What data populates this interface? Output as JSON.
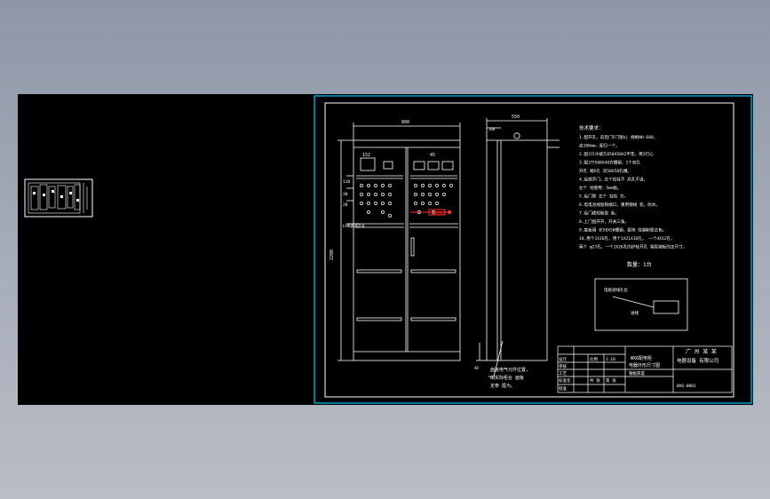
{
  "dimensions": {
    "overall_width": "800",
    "side_depth": "550",
    "side_offset": "100",
    "height": "2200",
    "top_left": "152",
    "top_right": "45",
    "side_bottom": "40",
    "h1": "110",
    "h2": "30",
    "h3": "20"
  },
  "notes_title": "技术要求：",
  "notes": [
    "1.配开孔，前后门F门锁kj  规格NH-600,",
    "  高100mm，配日一个。",
    "2.配2只冷端方850X50X2平垫，用2行心",
    "3.配2只500X40方槽钢，1个双孔",
    "  开孔 端X孔 双50X50孔槽。",
    "4.后部开门，左个柱柱不 局孔不设。",
    "  左个 柱使用：5mm板。",
    "5.后门管 左个 柱柱 方。",
    "6.电电池线窗铜端口，重用钢线 装。防水。",
    "7.后门锁短板型 板。",
    "8.上门盘开开，开关三角。",
    "9.底板用 长50X50槽钢，接地 柱钢制要正色。",
    "10.用个1X16孔，用个1X21X16孔， 一个4X12孔，",
    "  两个 φ27孔，一个1X26孔的护栓开孔 端局坡板的正尺寸。"
  ],
  "quantity_label": "数量：1台",
  "box_label": "电缆进线孔位",
  "box_small": "进线",
  "side_note": [
    "面板电气元件位置,",
    "由实际柜台 面板",
    "定参 厘为。"
  ],
  "left_label": "LV断路器开关",
  "red_label": "电缆接线",
  "title_block": {
    "company_line1": "广 州 某 某",
    "company_line2": "电器设备 有限公司",
    "drawing_name_1": "WX6配电柜",
    "drawing_name_2": "电器外形尺寸图",
    "code": "WX6-0001",
    "rows_left": [
      "设计",
      "审核",
      "工艺",
      "标准化",
      "批准",
      "日期"
    ],
    "cells": [
      "比例",
      "1:10",
      "共  张",
      "第  张"
    ],
    "material": "钢板厚度"
  },
  "colors": {
    "line": "#ffffff",
    "panel": "#e8e8e8",
    "frame_blue": "#00c8ff",
    "red": "#ff3030",
    "background": "#000000"
  }
}
